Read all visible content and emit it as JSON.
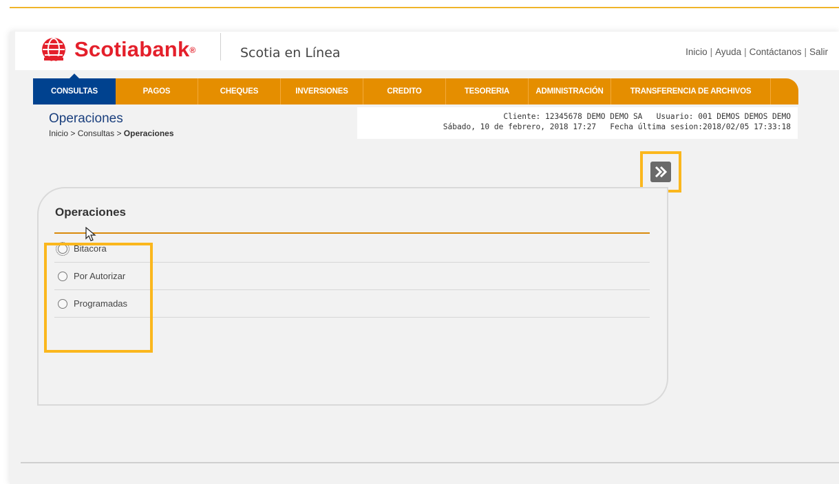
{
  "brand": {
    "name": "Scotiabank",
    "registered_mark": "®",
    "product": "Scotia en Línea",
    "color": "#e4202b"
  },
  "util_links": [
    "Inicio",
    "Ayuda",
    "Contáctanos",
    "Salir"
  ],
  "nav": {
    "items": [
      {
        "label": "CONSULTAS",
        "active": true
      },
      {
        "label": "PAGOS",
        "active": false
      },
      {
        "label": "CHEQUES",
        "active": false
      },
      {
        "label": "INVERSIONES",
        "active": false
      },
      {
        "label": "CREDITO",
        "active": false
      },
      {
        "label": "TESORERIA",
        "active": false
      },
      {
        "label": "ADMINISTRACIÓN",
        "active": false
      },
      {
        "label": "TRANSFERENCIA DE ARCHIVOS",
        "active": false
      }
    ],
    "bar_color": "#e58e00",
    "active_color": "#00428f"
  },
  "page": {
    "title": "Operaciones",
    "breadcrumb": {
      "inicio": "Inicio",
      "consultas": "Consultas",
      "current": "Operaciones",
      "separator": ">"
    }
  },
  "session": {
    "client_label": "Cliente:",
    "client_value": "12345678 DEMO DEMO SA",
    "user_label": "Usuario:",
    "user_value": "001 DEMOS DEMOS DEMO",
    "date": "Sábado, 10 de febrero, 2018 17:27",
    "last_session_label": "Fecha última sesion:",
    "last_session_value": "2018/02/05 17:33:18"
  },
  "panel": {
    "title": "Operaciones",
    "options": [
      {
        "label": "Bitacora",
        "selected": false,
        "focused": true
      },
      {
        "label": "Por Autorizar",
        "selected": false,
        "focused": false
      },
      {
        "label": "Programadas",
        "selected": false,
        "focused": false
      }
    ]
  },
  "icons": {
    "next": "double-chevron-right-icon",
    "logo": "scotiabank-flame-icon"
  }
}
